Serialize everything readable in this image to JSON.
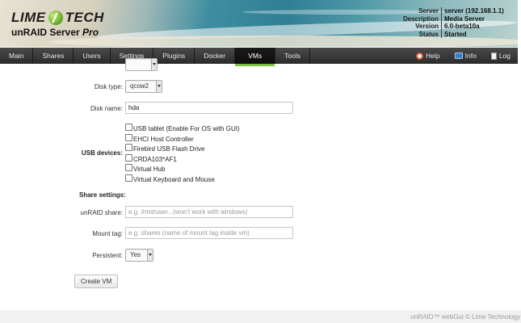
{
  "header": {
    "brand_left": "LIME",
    "brand_right": "TECH",
    "subtitle_main": "unRAID Server",
    "subtitle_pro": "Pro",
    "server_info": [
      {
        "key": "Server",
        "value": "server (192.168.1.1)"
      },
      {
        "key": "Description",
        "value": "Media Server"
      },
      {
        "key": "Version",
        "value": "6.0-beta10a"
      },
      {
        "key": "Status",
        "value": "Started"
      }
    ]
  },
  "nav": {
    "tabs": [
      "Main",
      "Shares",
      "Users",
      "Settings",
      "Plugins",
      "Docker",
      "VMs",
      "Tools"
    ],
    "active": "VMs",
    "help_label": "Help",
    "info_label": "Info",
    "log_label": "Log"
  },
  "form": {
    "disk_type_label": "Disk type:",
    "disk_type_value": "qcow2",
    "disk_name_label": "Disk name:",
    "disk_name_value": "hda",
    "usb_label": "USB devices:",
    "usb_devices": [
      "USB tablet (Enable For OS with GUI)",
      "EHCI Host Controller",
      "Firebird USB Flash Drive",
      "CRDA103*AF1",
      "Virtual Hub",
      "Virtual Keyboard and Mouse"
    ],
    "share_settings_label": "Share settings:",
    "unraid_share_label": "unRAID share:",
    "unraid_share_placeholder": "e.g. /mnt/user...(won't work with windows)",
    "mount_tag_label": "Mount tag:",
    "mount_tag_placeholder": "e.g. shares (name of mount tag inside vm)",
    "persistent_label": "Persistent:",
    "persistent_value": "Yes",
    "create_button": "Create VM"
  },
  "footer": {
    "text": "unRAID™ webGui © Lime Technology"
  },
  "colors": {
    "nav_bg": "#2b2b2b",
    "active_tab_underline": "#7dc142",
    "help_icon": "#e4572e",
    "info_icon": "#3d7fc4"
  }
}
